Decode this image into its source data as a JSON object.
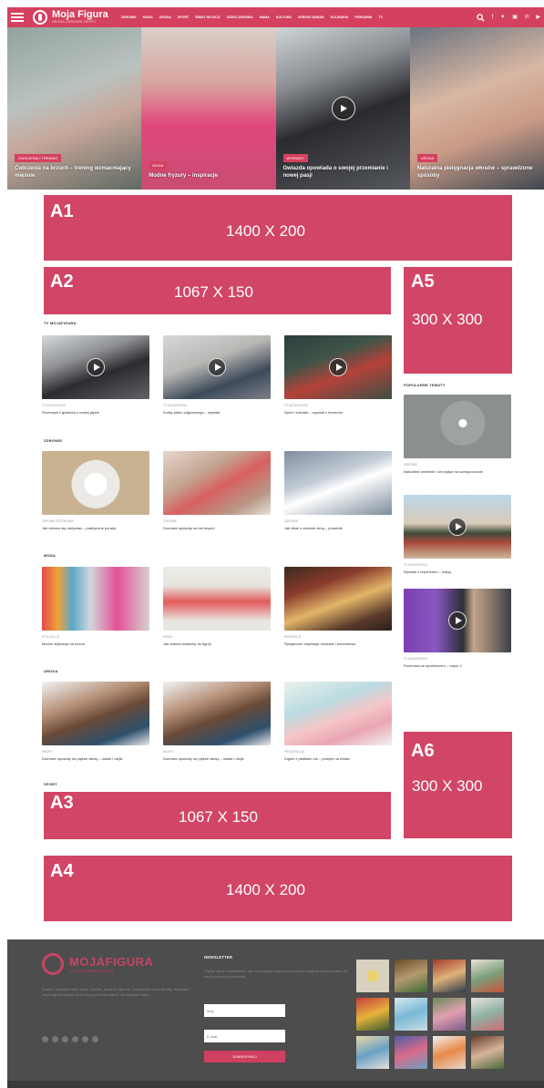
{
  "header": {
    "logo_title": "Moja Figura",
    "logo_subtitle": "URODA ZDROWIE SPORT",
    "nav": [
      "ZDROWIE",
      "MODA",
      "URODA",
      "SPORT",
      "ŚWIAT INTUICJI",
      "DZIECI ZDROWO",
      "MAMA",
      "KULTURA",
      "ZDRÓW ZAMIAR",
      "KULINARIA",
      "PORADNIK",
      "TV"
    ],
    "icons": {
      "search": "search-icon",
      "facebook": "facebook-icon",
      "twitter": "twitter-icon",
      "instagram": "instagram-icon",
      "pinterest": "pinterest-icon",
      "youtube": "youtube-icon"
    }
  },
  "hero": [
    {
      "badge": "ĆWICZENIA I TRENING",
      "title": "Ćwiczenia na brzuch – trening wzmacniający mięśnie"
    },
    {
      "badge": "MODA",
      "title": "Modne fryzury – inspiracje"
    },
    {
      "badge": "WYWIADY",
      "title": "Gwiazda opowiada o swojej przemianie i nowej pasji"
    },
    {
      "badge": "URODA",
      "title": "Naturalna pielęgnacja włosów – sprawdzone sposoby"
    }
  ],
  "ads": {
    "a1": {
      "code": "A1",
      "size": "1400 X 200"
    },
    "a2": {
      "code": "A2",
      "size": "1067 X 150"
    },
    "a3": {
      "code": "A3",
      "size": "1067 X 150"
    },
    "a4": {
      "code": "A4",
      "size": "1400 X 200"
    },
    "a5": {
      "code": "A5",
      "size": "300 X 300"
    },
    "a6": {
      "code": "A6",
      "size": "300 X 300"
    }
  },
  "sections": {
    "tv": {
      "title": "TV MOJAFIGURA",
      "items": [
        {
          "cat": "TV MOJAFIGURA",
          "title": "Rozmowa z gwiazdą o nowej płycie"
        },
        {
          "cat": "TV MOJAFIGURA",
          "title": "Kulisy planu zdjęciowego – wywiad"
        },
        {
          "cat": "TV MOJAFIGURA",
          "title": "Sport i zdrowie – wywiad z trenerem"
        }
      ]
    },
    "zdrowie": {
      "title": "ZDROWIE",
      "items": [
        {
          "cat": "ZDROWE ODŻYWIANIE",
          "title": "Jak zdrowo się odżywiać – praktyczne porady"
        },
        {
          "cat": "ZDROWIE",
          "title": "Domowe sposoby na ból mięśni"
        },
        {
          "cat": "ZDROWIE",
          "title": "Jak dbać o zdrowie zimą – poradnik"
        }
      ]
    },
    "moda": {
      "title": "MODA",
      "items": [
        {
          "cat": "STYLIZACJE",
          "title": "Modne stylizacje na sezon"
        },
        {
          "cat": "MODA",
          "title": "Jak dobrać sukienkę do figury"
        },
        {
          "cat": "INSPIRACJE",
          "title": "Świąteczne inspiracje modowe i prezentowe"
        }
      ]
    },
    "uroda": {
      "title": "URODA",
      "items": [
        {
          "cat": "WŁOSY",
          "title": "Domowe sposoby na piękne włosy – maski i olejki"
        },
        {
          "cat": "WŁOSY",
          "title": "Domowe sposoby na piękne włosy – maski i olejki"
        },
        {
          "cat": "PIELĘGNACJA",
          "title": "Kąpiel z płatkami róż – przepis na relaks"
        }
      ]
    },
    "sport": {
      "title": "SPORT"
    },
    "popular": {
      "title": "POPULARNE TEMATY",
      "items": [
        {
          "cat": "ZDROWIE",
          "title": "Naturalne kamienie i ich wpływ na samopoczucie"
        },
        {
          "cat": "TV MOJAFIGURA",
          "title": "Wywiad z reporterem – kulisy"
        },
        {
          "cat": "TV MOJAFIGURA",
          "title": "Rozmowa ze sportowcem – część 2"
        }
      ]
    }
  },
  "footer": {
    "logo_title": "MOJAFIGURA",
    "logo_subtitle": "URODA ZDROWIE SPORT",
    "about": "Portal o zdrowym stylu życia, urodzie, modzie i sporcie. Codziennie nowe porady, wywiady i inspiracje dla kobiet, które chcą czuć się dobrze we własnym ciele.",
    "newsletter_title": "NEWSLETTER",
    "newsletter_text": "Zapisz się do newslettera, aby otrzymywać najnowsze porady i artykuły bezpośrednio na swoją skrzynkę pocztową.",
    "name_placeholder": "Imię",
    "email_placeholder": "E-mail",
    "subscribe": "SUBSKRYBUJ"
  }
}
